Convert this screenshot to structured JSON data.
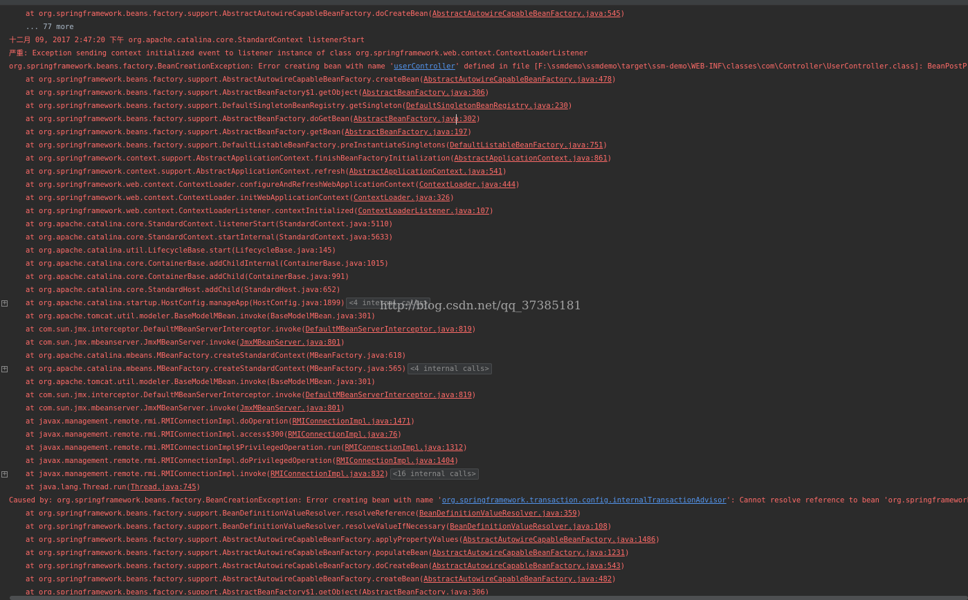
{
  "lines": [
    {
      "text": "at org.springframework.beans.factory.support.AbstractAutowireCapableBeanFactory.doCreateBean(",
      "link": "AbstractAutowireCapableBeanFactory.java:545",
      "after": ")"
    },
    {
      "text": "... 77 more"
    },
    {
      "text": "十二月 09, 2017 2:47:20 下午 org.apache.catalina.core.StandardContext listenerStart"
    },
    {
      "text": "严重: Exception sending context initialized event to listener instance of class org.springframework.web.context.ContextLoaderListener"
    },
    {
      "text": "org.springframework.beans.factory.BeanCreationException: Error creating bean with name '",
      "highlight": "userController",
      "after": "' defined in file [F:\\ssmdemo\\ssmdemo\\target\\ssm-demo\\WEB-INF\\classes\\com\\Controller\\UserController.class]: BeanPostProcessor before instantiation of bean failed"
    },
    {
      "text": "at org.springframework.beans.factory.support.AbstractAutowireCapableBeanFactory.createBean(",
      "link": "AbstractAutowireCapableBeanFactory.java:478",
      "after": ")"
    },
    {
      "text": "at org.springframework.beans.factory.support.AbstractBeanFactory$1.getObject(",
      "link": "AbstractBeanFactory.java:306",
      "after": ")"
    },
    {
      "text": "at org.springframework.beans.factory.support.DefaultSingletonBeanRegistry.getSingleton(",
      "link": "DefaultSingletonBeanRegistry.java:230",
      "after": ")"
    },
    {
      "text": "at org.springframework.beans.factory.support.AbstractBeanFactory.doGetBean(",
      "link": "AbstractBeanFactory.java:302",
      "after": ")"
    },
    {
      "text": "at org.springframework.beans.factory.support.AbstractBeanFactory.getBean(",
      "link": "AbstractBeanFactory.java:197",
      "after": ")"
    },
    {
      "text": "at org.springframework.beans.factory.support.DefaultListableBeanFactory.preInstantiateSingletons(",
      "link": "DefaultListableBeanFactory.java:751",
      "after": ")"
    },
    {
      "text": "at org.springframework.context.support.AbstractApplicationContext.finishBeanFactoryInitialization(",
      "link": "AbstractApplicationContext.java:861",
      "after": ")"
    },
    {
      "text": "at org.springframework.context.support.AbstractApplicationContext.refresh(",
      "link": "AbstractApplicationContext.java:541",
      "after": ")"
    },
    {
      "text": "at org.springframework.web.context.ContextLoader.configureAndRefreshWebApplicationContext(",
      "link": "ContextLoader.java:444",
      "after": ")"
    },
    {
      "text": "at org.springframework.web.context.ContextLoader.initWebApplicationContext(",
      "link": "ContextLoader.java:326",
      "after": ")"
    },
    {
      "text": "at org.springframework.web.context.ContextLoaderListener.contextInitialized(",
      "link": "ContextLoaderListener.java:107",
      "after": ")"
    },
    {
      "text": "at org.apache.catalina.core.StandardContext.listenerStart(StandardContext.java:5110)"
    },
    {
      "text": "at org.apache.catalina.core.StandardContext.startInternal(StandardContext.java:5633)"
    },
    {
      "text": "at org.apache.catalina.util.LifecycleBase.start(LifecycleBase.java:145)"
    },
    {
      "text": "at org.apache.catalina.core.ContainerBase.addChildInternal(ContainerBase.java:1015)"
    },
    {
      "text": "at org.apache.catalina.core.ContainerBase.addChild(ContainerBase.java:991)"
    },
    {
      "text": "at org.apache.catalina.core.StandardHost.addChild(StandardHost.java:652)"
    },
    {
      "text": "at org.apache.catalina.startup.HostConfig.manageApp(HostConfig.java:1899)",
      "folded": "<4 internal calls>"
    },
    {
      "text": "at org.apache.tomcat.util.modeler.BaseModelMBean.invoke(BaseModelMBean.java:301)"
    },
    {
      "text": "at com.sun.jmx.interceptor.DefaultMBeanServerInterceptor.invoke(",
      "link": "DefaultMBeanServerInterceptor.java:819",
      "after": ")"
    },
    {
      "text": "at com.sun.jmx.mbeanserver.JmxMBeanServer.invoke(",
      "link": "JmxMBeanServer.java:801",
      "after": ")"
    },
    {
      "text": "at org.apache.catalina.mbeans.MBeanFactory.createStandardContext(MBeanFactory.java:618)"
    },
    {
      "text": "at org.apache.catalina.mbeans.MBeanFactory.createStandardContext(MBeanFactory.java:565)",
      "folded": "<4 internal calls>"
    },
    {
      "text": "at org.apache.tomcat.util.modeler.BaseModelMBean.invoke(BaseModelMBean.java:301)"
    },
    {
      "text": "at com.sun.jmx.interceptor.DefaultMBeanServerInterceptor.invoke(",
      "link": "DefaultMBeanServerInterceptor.java:819",
      "after": ")"
    },
    {
      "text": "at com.sun.jmx.mbeanserver.JmxMBeanServer.invoke(",
      "link": "JmxMBeanServer.java:801",
      "after": ")"
    },
    {
      "text": "at javax.management.remote.rmi.RMIConnectionImpl.doOperation(",
      "link": "RMIConnectionImpl.java:1471",
      "after": ")"
    },
    {
      "text": "at javax.management.remote.rmi.RMIConnectionImpl.access$300(",
      "link": "RMIConnectionImpl.java:76",
      "after": ")"
    },
    {
      "text": "at javax.management.remote.rmi.RMIConnectionImpl$PrivilegedOperation.run(",
      "link": "RMIConnectionImpl.java:1312",
      "after": ")"
    },
    {
      "text": "at javax.management.remote.rmi.RMIConnectionImpl.doPrivilegedOperation(",
      "link": "RMIConnectionImpl.java:1404",
      "after": ")"
    },
    {
      "text": "at javax.management.remote.rmi.RMIConnectionImpl.invoke(",
      "link": "RMIConnectionImpl.java:832",
      "after": ")",
      "folded": "<16 internal calls>"
    },
    {
      "text": "at java.lang.Thread.run(",
      "link": "Thread.java:745",
      "after": ")"
    },
    {
      "text": "Caused by: org.springframework.beans.factory.BeanCreationException: Error creating bean with name '",
      "highlight": "org.springframework.transaction.config.internalTransactionAdvisor",
      "after": "': Cannot resolve reference to bean 'org.springframework.transaction.interceptor.TransactionInterceptor'"
    },
    {
      "text": "at org.springframework.beans.factory.support.BeanDefinitionValueResolver.resolveReference(",
      "link": "BeanDefinitionValueResolver.java:359",
      "after": ")"
    },
    {
      "text": "at org.springframework.beans.factory.support.BeanDefinitionValueResolver.resolveValueIfNecessary(",
      "link": "BeanDefinitionValueResolver.java:108",
      "after": ")"
    },
    {
      "text": "at org.springframework.beans.factory.support.AbstractAutowireCapableBeanFactory.applyPropertyValues(",
      "link": "AbstractAutowireCapableBeanFactory.java:1486",
      "after": ")"
    },
    {
      "text": "at org.springframework.beans.factory.support.AbstractAutowireCapableBeanFactory.populateBean(",
      "link": "AbstractAutowireCapableBeanFactory.java:1231",
      "after": ")"
    },
    {
      "text": "at org.springframework.beans.factory.support.AbstractAutowireCapableBeanFactory.doCreateBean(",
      "link": "AbstractAutowireCapableBeanFactory.java:543",
      "after": ")"
    },
    {
      "text": "at org.springframework.beans.factory.support.AbstractAutowireCapableBeanFactory.createBean(",
      "link": "AbstractAutowireCapableBeanFactory.java:482",
      "after": ")"
    },
    {
      "text": "at org.springframework.beans.factory.support.AbstractBeanFactory$1.getObject(",
      "link": "AbstractBeanFactory.java:306",
      "after": ")"
    }
  ],
  "watermark": "http://blog.csdn.net/qq_37385181",
  "fold_icon": "+",
  "colors": {
    "background": "#2b2b2b",
    "error_text": "#ff6b68",
    "plain_text": "#a9b7c6",
    "hyperlink": "#5394ec"
  }
}
